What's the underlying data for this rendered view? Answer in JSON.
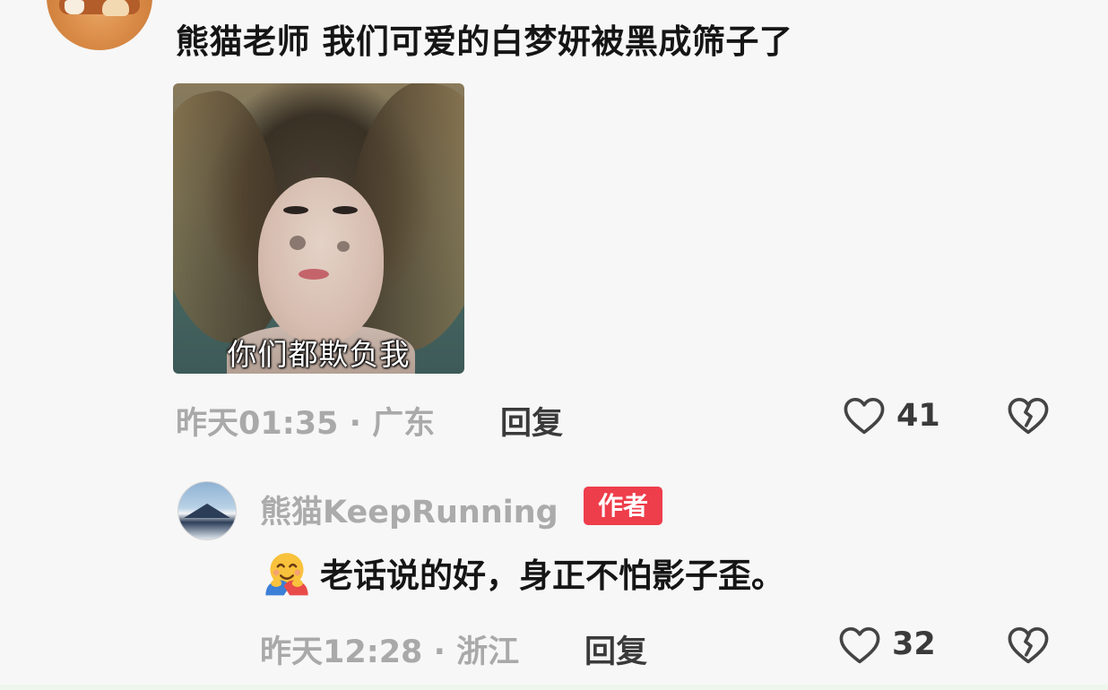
{
  "comment": {
    "text": "熊猫老师 我们可爱的白梦妍被黑成筛子了",
    "image_caption": "你们都欺负我",
    "time": "昨天01:35",
    "separator": "·",
    "location": "广东",
    "reply_label": "回复",
    "likes": "41"
  },
  "reply": {
    "username": "熊猫KeepRunning",
    "badge": "作者",
    "text": "老话说的好，身正不怕影子歪。",
    "time": "昨天12:28",
    "separator": "·",
    "location": "浙江",
    "reply_label": "回复",
    "likes": "32"
  },
  "colors": {
    "meta_gray": "#a9a9a9",
    "badge_red": "#ee3d4b",
    "text_dark": "#151515"
  },
  "icons": {
    "like": "heart-outline-icon",
    "dislike": "broken-heart-outline-icon",
    "reaction_emoji": "smiling-face-with-open-hands-emoji"
  }
}
